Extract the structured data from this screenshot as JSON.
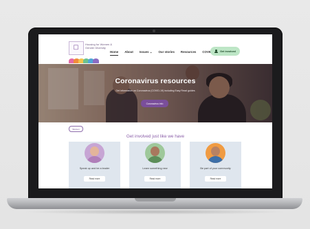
{
  "site": {
    "logo": {
      "glyph": "▢",
      "text": "Housing for Women & Gender Diversity"
    },
    "logo_colors": [
      "#e56aa6",
      "#f08c3a",
      "#f3c44d",
      "#6cc18f",
      "#4fa6d8",
      "#8b6cc2"
    ],
    "nav": {
      "items": [
        "Home",
        "About",
        "Issues",
        "Our stories",
        "Resources",
        "COVID19"
      ],
      "issues_chevron": "⌄",
      "cta": "Get involved"
    },
    "hero": {
      "title": "Coronavirus resources",
      "subtitle": "Get information on Coronavirus (COVID-19) including Easy Read guides",
      "button": "Coronavirus info"
    },
    "section": {
      "pill": "Women",
      "title": "Get involved just like we have",
      "cards": [
        {
          "label": "Speak up and be a leader",
          "button": "Read more",
          "face": "#e3b59b",
          "body": "#b07fb9",
          "bg": "#c7a5d4"
        },
        {
          "label": "Learn something new",
          "button": "Read more",
          "face": "#a9785e",
          "body": "#5d8e5a",
          "bg": "#9ec89a"
        },
        {
          "label": "Be part of your community",
          "button": "Read more",
          "face": "#b98262",
          "body": "#3d6fa8",
          "bg": "#f09b42"
        }
      ]
    }
  },
  "colors": {
    "accent": "#7a4e9b",
    "cta_bg": "#bde6c6",
    "card_bg": "#dfe6ee"
  }
}
